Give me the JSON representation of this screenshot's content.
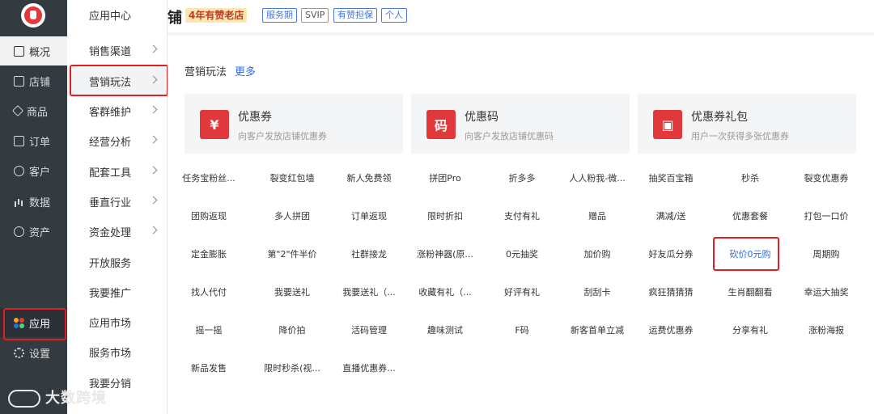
{
  "sidebar": {
    "items": [
      {
        "label": "概况",
        "icon": "monitor-icon"
      },
      {
        "label": "店铺",
        "icon": "shop-icon"
      },
      {
        "label": "商品",
        "icon": "tag-icon"
      },
      {
        "label": "订单",
        "icon": "order-icon"
      },
      {
        "label": "客户",
        "icon": "user-icon"
      },
      {
        "label": "数据",
        "icon": "bar-chart-icon"
      },
      {
        "label": "资产",
        "icon": "coin-icon"
      },
      {
        "label": "应用",
        "icon": "apps-icon"
      },
      {
        "label": "设置",
        "icon": "gear-icon"
      }
    ]
  },
  "submenu": {
    "items": [
      {
        "label": "应用中心"
      },
      {
        "label": "销售渠道"
      },
      {
        "label": "营销玩法"
      },
      {
        "label": "客群维护"
      },
      {
        "label": "经营分析"
      },
      {
        "label": "配套工具"
      },
      {
        "label": "垂直行业"
      },
      {
        "label": "资金处理"
      },
      {
        "label": "开放服务"
      },
      {
        "label": "我要推广"
      },
      {
        "label": "应用市场"
      },
      {
        "label": "服务市场"
      },
      {
        "label": "我要分销"
      }
    ]
  },
  "header": {
    "shop_name_tail": "铺",
    "badge": "4年有赞老店",
    "tags": [
      "服务期",
      "SVIP",
      "有赞担保",
      "个人"
    ]
  },
  "marketing": {
    "title": "营销玩法",
    "more": "更多",
    "cards": [
      {
        "title": "优惠券",
        "desc": "向客户发放店铺优惠券",
        "icon_glyph": "¥"
      },
      {
        "title": "优惠码",
        "desc": "向客户发放店铺优惠码",
        "icon_glyph": "码"
      },
      {
        "title": "优惠券礼包",
        "desc": "用户一次获得多张优惠券",
        "icon_glyph": "▣"
      }
    ],
    "grid": [
      [
        "任务宝粉丝...",
        "裂变红包墙",
        "新人免费领",
        "拼团Pro",
        "折多多",
        "人人粉我-微...",
        "抽奖百宝箱",
        "秒杀",
        "裂变优惠券"
      ],
      [
        "团购返现",
        "多人拼团",
        "订单返现",
        "限时折扣",
        "支付有礼",
        "赠品",
        "满减/送",
        "优惠套餐",
        "打包一口价"
      ],
      [
        "定金膨胀",
        "第\"2\"件半价",
        "社群接龙",
        "涨粉神器(原...",
        "0元抽奖",
        "加价购",
        "好友瓜分券",
        "砍价0元购",
        "周期购"
      ],
      [
        "找人代付",
        "我要送礼",
        "我要送礼（...",
        "收藏有礼（...",
        "好评有礼",
        "刮刮卡",
        "疯狂猜猜猜",
        "生肖翻翻看",
        "幸运大抽奖"
      ],
      [
        "摇一摇",
        "降价拍",
        "活码管理",
        "趣味测试",
        "F码",
        "新客首单立减",
        "运费优惠券",
        "分享有礼",
        "涨粉海报"
      ],
      [
        "新品发售",
        "限时秒杀(视...",
        "直播优惠券..."
      ]
    ]
  },
  "watermark": "大数跨境",
  "colors": {
    "accent": "#2d6ee6",
    "brand_red": "#e1393b",
    "sidebar": "#333a40"
  }
}
